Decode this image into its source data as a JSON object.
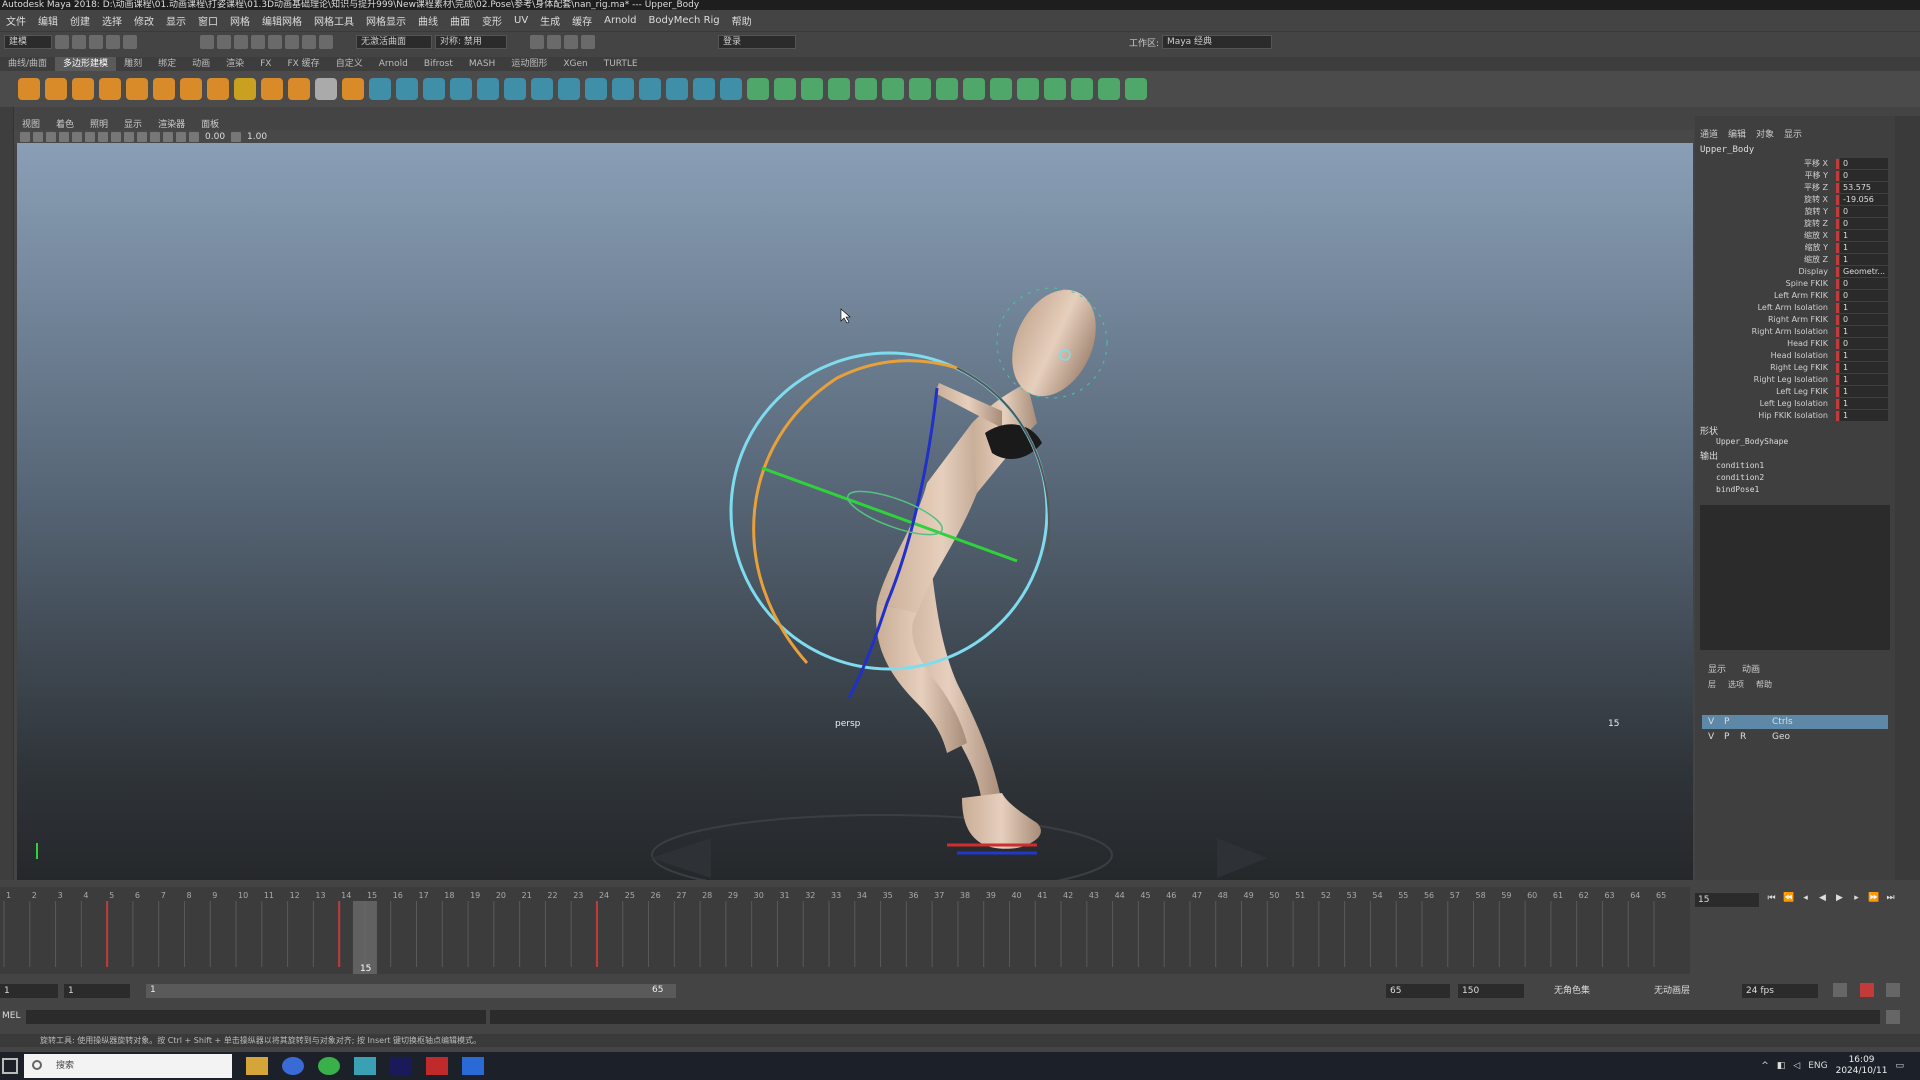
{
  "window": {
    "title": "Autodesk Maya 2018: D:\\动画课程\\01.动画课程\\打姿课程\\01.3D动画基础理论\\知识与提升999\\New课程素材\\完成\\02.Pose\\参考\\身体配套\\nan_rig.ma*  ---  Upper_Body"
  },
  "menu": [
    "文件",
    "编辑",
    "创建",
    "选择",
    "修改",
    "显示",
    "窗口",
    "网格",
    "编辑网格",
    "网格工具",
    "网格显示",
    "曲线",
    "曲面",
    "变形",
    "UV",
    "生成",
    "缓存",
    "Arnold",
    "BodyMech Rig",
    "帮助"
  ],
  "status": {
    "mode": "建模",
    "symmetry_label": "无激活曲面",
    "sym_field": "对称: 禁用",
    "login": "登录",
    "workspace_label": "工作区:",
    "workspace_value": "Maya 经典"
  },
  "shelf_tabs": [
    "曲线/曲面",
    "多边形建模",
    "雕刻",
    "绑定",
    "动画",
    "渲染",
    "FX",
    "FX 缓存",
    "自定义",
    "Arnold",
    "Bifrost",
    "MASH",
    "运动图形",
    "XGen",
    "TURTLE"
  ],
  "shelf_active": "多边形建模",
  "panel_menu": [
    "视图",
    "着色",
    "照明",
    "显示",
    "渲染器",
    "面板"
  ],
  "panel_values": {
    "exposure": "0.00",
    "gamma": "1.00"
  },
  "viewport": {
    "camera": "persp",
    "frame_hud": "15"
  },
  "channelbox": {
    "tabs": [
      "通道",
      "编辑",
      "对象",
      "显示"
    ],
    "object": "Upper_Body",
    "attrs": [
      {
        "label": "平移 X",
        "value": "0"
      },
      {
        "label": "平移 Y",
        "value": "0"
      },
      {
        "label": "平移 Z",
        "value": "53.575"
      },
      {
        "label": "旋转 X",
        "value": "-19.056"
      },
      {
        "label": "旋转 Y",
        "value": "0"
      },
      {
        "label": "旋转 Z",
        "value": "0"
      },
      {
        "label": "缩放 X",
        "value": "1"
      },
      {
        "label": "缩放 Y",
        "value": "1"
      },
      {
        "label": "缩放 Z",
        "value": "1"
      },
      {
        "label": "Display",
        "value": "Geometr..."
      },
      {
        "label": "Spine FKIK",
        "value": "0"
      },
      {
        "label": "Left Arm FKIK",
        "value": "0"
      },
      {
        "label": "Left Arm Isolation",
        "value": "1"
      },
      {
        "label": "Right Arm FKIK",
        "value": "0"
      },
      {
        "label": "Right Arm Isolation",
        "value": "1"
      },
      {
        "label": "Head FKIK",
        "value": "0"
      },
      {
        "label": "Head Isolation",
        "value": "1"
      },
      {
        "label": "Right Leg FKIK",
        "value": "1"
      },
      {
        "label": "Right Leg Isolation",
        "value": "1"
      },
      {
        "label": "Left Leg FKIK",
        "value": "1"
      },
      {
        "label": "Left Leg Isolation",
        "value": "1"
      },
      {
        "label": "Hip FKIK Isolation",
        "value": "1"
      }
    ],
    "shapes_header": "形状",
    "shape_name": "Upper_BodyShape",
    "outputs_header": "输出",
    "outputs": [
      "condition1",
      "condition2",
      "bindPose1"
    ]
  },
  "layers": {
    "tabs": [
      "显示",
      "动画"
    ],
    "menu": [
      "层",
      "选项",
      "帮助"
    ],
    "rows": [
      {
        "v": "V",
        "p": "P",
        "r": "",
        "name": "Ctrls",
        "selected": true
      },
      {
        "v": "V",
        "p": "P",
        "r": "R",
        "name": "Geo",
        "selected": false
      }
    ]
  },
  "timeline": {
    "start": 1,
    "end": 65,
    "current": 15,
    "current_label": "15",
    "keys": [
      5,
      14,
      24
    ],
    "current_field": "15"
  },
  "range": {
    "start": "1",
    "inner_start": "1",
    "inner_end": "65",
    "end": "65",
    "anim_end": "150",
    "char_set": "无角色集",
    "anim_layer": "无动画层",
    "fps": "24 fps"
  },
  "cmd": {
    "label": "MEL"
  },
  "help_text": "旋转工具: 使用操纵器旋转对象。按 Ctrl + Shift + 单击操纵器以将其旋转到与对象对齐; 按 Insert 键切换枢轴点编辑模式。",
  "taskbar": {
    "search_placeholder": "搜索",
    "lang": "ENG",
    "time": "16:09",
    "date": "2024/10/11"
  },
  "colors": {
    "accent": "#5d88a8",
    "key": "#c23a3a",
    "ring": "#7fdcef",
    "arc": "#e8a13a",
    "green": "#2fd23a",
    "blue": "#2030c8"
  }
}
